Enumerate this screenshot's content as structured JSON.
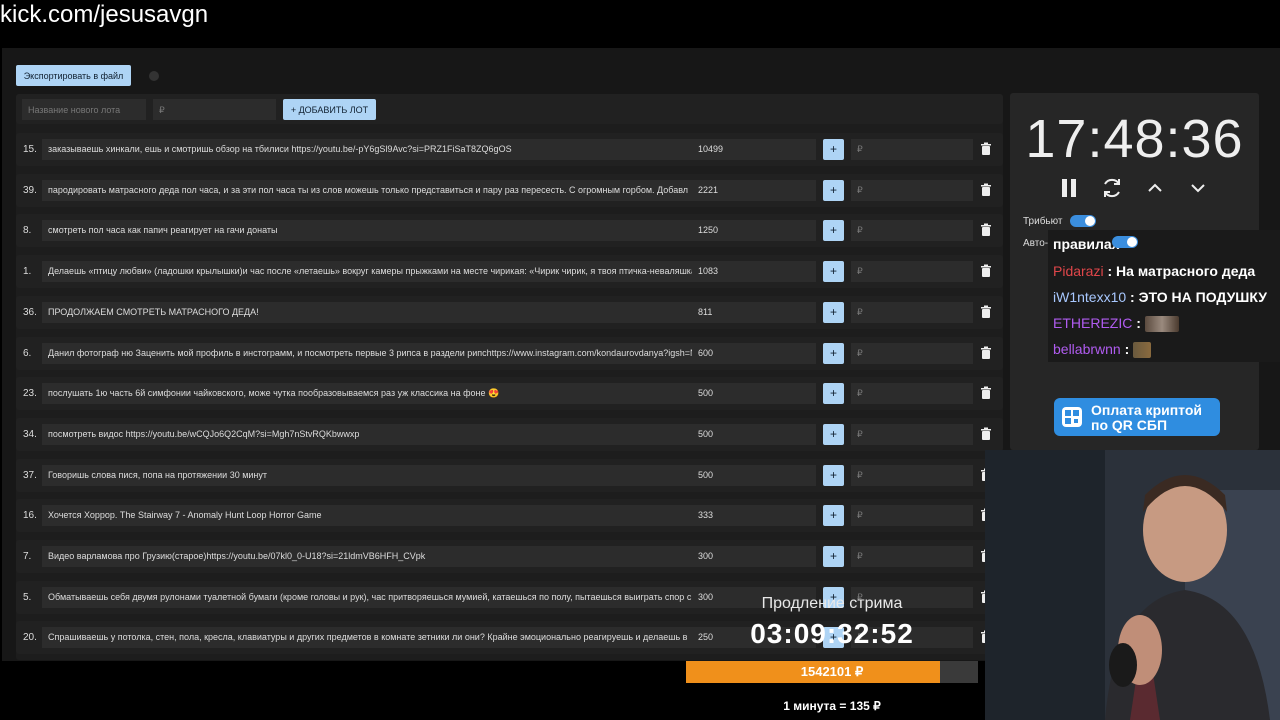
{
  "url": "kick.com/jesusavgn",
  "toolbar": {
    "export_label": "Экспортировать в файл"
  },
  "new_lot": {
    "name_placeholder": "Название нового лота",
    "sum_placeholder": "₽",
    "add_label": "+ ДОБАВИТЬ ЛОТ"
  },
  "lots": [
    {
      "num": "15.",
      "name": "заказываешь хинкали, ешь и смотришь обзор на тбилиси https://youtu.be/-pY6gSl9Avc?si=PRZ1FiSaT8ZQ6gOS",
      "sum": "10499"
    },
    {
      "num": "39.",
      "name": "пародировать матрасного деда пол часа, и за эти пол часа ты из слов можешь только представиться и пару раз пересесть. С огромным горбом. Добавл",
      "sum": "2221"
    },
    {
      "num": "8.",
      "name": "смотреть пол часа как папич реагирует на гачи донаты",
      "sum": "1250"
    },
    {
      "num": "1.",
      "name": "Делаешь «птицу любви» (ладошки крылышки)и час после «летаешь» вокруг камеры прыжками на месте чирикая: «Чирик чирик, я твоя птичка-неваляшка",
      "sum": "1083"
    },
    {
      "num": "36.",
      "name": "ПРОДОЛЖАЕМ СМОТРЕТЬ МАТРАСНОГО ДЕДА!",
      "sum": "811"
    },
    {
      "num": "6.",
      "name": "Данил фотограф ню Заценить мой профиль в инстограмм, и посмотреть первые 3 рипса в раздели рипсhttps://www.instagram.com/kondaurovdanya?igsh=N",
      "sum": "600"
    },
    {
      "num": "23.",
      "name": "послушать 1ю часть 6й симфонии чайковского, може чутка пообразовываемся раз уж классика на фоне 😍",
      "sum": "500"
    },
    {
      "num": "34.",
      "name": "посмотреть видос https://youtu.be/wCQJo6Q2CqM?si=Mgh7nStvRQKbwwxp",
      "sum": "500"
    },
    {
      "num": "37.",
      "name": "Говоришь слова пися, попа на протяжении 30 минут",
      "sum": "500"
    },
    {
      "num": "16.",
      "name": "Хочется Хоррор. The Stairway 7 - Anomaly Hunt Loop Horror Game",
      "sum": "333"
    },
    {
      "num": "7.",
      "name": "Видео варламова про Грузию(старое)https://youtu.be/07kl0_0-U18?si=21ldmVB6HFH_CVpk",
      "sum": "300"
    },
    {
      "num": "5.",
      "name": "Обматываешь себя двумя рулонами туалетной бумаги (кроме головы и рук), час притворяешься мумией, катаешься по полу, пытаешься выиграть спор с",
      "sum": "300"
    },
    {
      "num": "20.",
      "name": "Спрашиваешь у потолка, стен, пола, кресла, клавиатуры и других предметов в комнате зетники ли они? Крайне эмоционально реагируешь и делаешь в",
      "sum": "250"
    }
  ],
  "lot_controls": {
    "plus": "+",
    "rub_placeholder": "₽"
  },
  "timer": {
    "time": "17:48:36",
    "tribute_label": "Трибьют",
    "auto_label": "Авто-"
  },
  "chat": {
    "top_fragment": "правилах",
    "messages": [
      {
        "user": "Pidarazi",
        "color": "#e0464a",
        "text": "На матрасного деда"
      },
      {
        "user": "iW1ntexx10",
        "color": "#a8c8ff",
        "text": "ЭТО НА ПОДУШКУ"
      },
      {
        "user": "ETHEREZIC",
        "color": "#b05cf0",
        "text": ""
      },
      {
        "user": "bellabrwnn",
        "color": "#b05cf0",
        "text": ""
      }
    ]
  },
  "payment": {
    "line1": "Оплата криптой",
    "line2": "по QR СБП"
  },
  "extension": {
    "label": "Продление стрима",
    "timer": "03:09:32:52",
    "amount": "1542101 ₽",
    "rate": "1 минута = 135 ₽",
    "progress_fraction": 0.87
  }
}
